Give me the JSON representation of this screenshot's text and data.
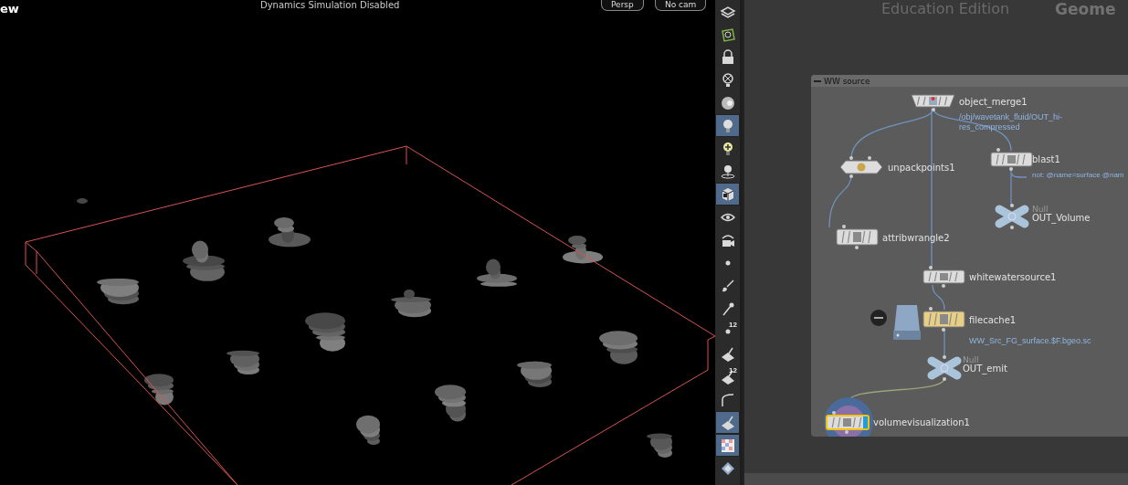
{
  "viewport": {
    "title": "ew",
    "status": "Dynamics Simulation Disabled",
    "buttons": [
      "Persp",
      "No cam"
    ]
  },
  "toolbar": [
    {
      "kind": "layers",
      "selected": false
    },
    {
      "kind": "shape",
      "selected": false
    },
    {
      "kind": "lock",
      "selected": false
    },
    {
      "kind": "bulb-x",
      "selected": false
    },
    {
      "kind": "ball",
      "selected": false
    },
    {
      "kind": "bulb",
      "selected": true
    },
    {
      "kind": "bulb-plus",
      "selected": false
    },
    {
      "kind": "bulb-stand",
      "selected": false
    },
    {
      "kind": "cube",
      "selected": true
    },
    {
      "kind": "eye",
      "selected": false
    },
    {
      "kind": "camera",
      "selected": false
    },
    {
      "kind": "dot",
      "selected": false
    },
    {
      "kind": "brush",
      "selected": false
    },
    {
      "kind": "pin",
      "selected": false
    },
    {
      "kind": "dot",
      "selected": false,
      "badge": "12"
    },
    {
      "kind": "paint",
      "selected": false
    },
    {
      "kind": "paint",
      "selected": false,
      "badge": "12"
    },
    {
      "kind": "curve",
      "selected": false
    },
    {
      "kind": "paint",
      "selected": true
    },
    {
      "kind": "checker",
      "selected": true
    },
    {
      "kind": "diamond",
      "selected": false
    }
  ],
  "network": {
    "edition": "Education Edition",
    "context": "Geome",
    "network_box": {
      "title": "WW source",
      "expanded": true
    },
    "nodes": [
      {
        "kind": "merge",
        "label": "object_merge1",
        "detail": [
          "/obj/wavetank_fluid/OUT_hi-",
          "res_compressed"
        ],
        "display": false
      },
      {
        "kind": "unpack",
        "label": "unpackpoints1",
        "display": false
      },
      {
        "kind": "sop",
        "label": "blast1",
        "detail": [
          "not: @name=surface @nam"
        ],
        "display": false
      },
      {
        "kind": "null",
        "type_label": "Null",
        "label": "OUT_Volume",
        "display": false
      },
      {
        "kind": "sop",
        "label": "attribwrangle2",
        "display": false
      },
      {
        "kind": "sop",
        "label": "whitewatersource1",
        "display": false
      },
      {
        "kind": "cache",
        "label": "filecache1",
        "detail": [
          "WW_Src_FG_surface.$F.bgeo.sc"
        ],
        "display": false
      },
      {
        "kind": "null",
        "type_label": "Null",
        "label": "OUT_emit",
        "display": false
      },
      {
        "kind": "sop",
        "label": "volumevisualization1",
        "display": true
      }
    ]
  }
}
